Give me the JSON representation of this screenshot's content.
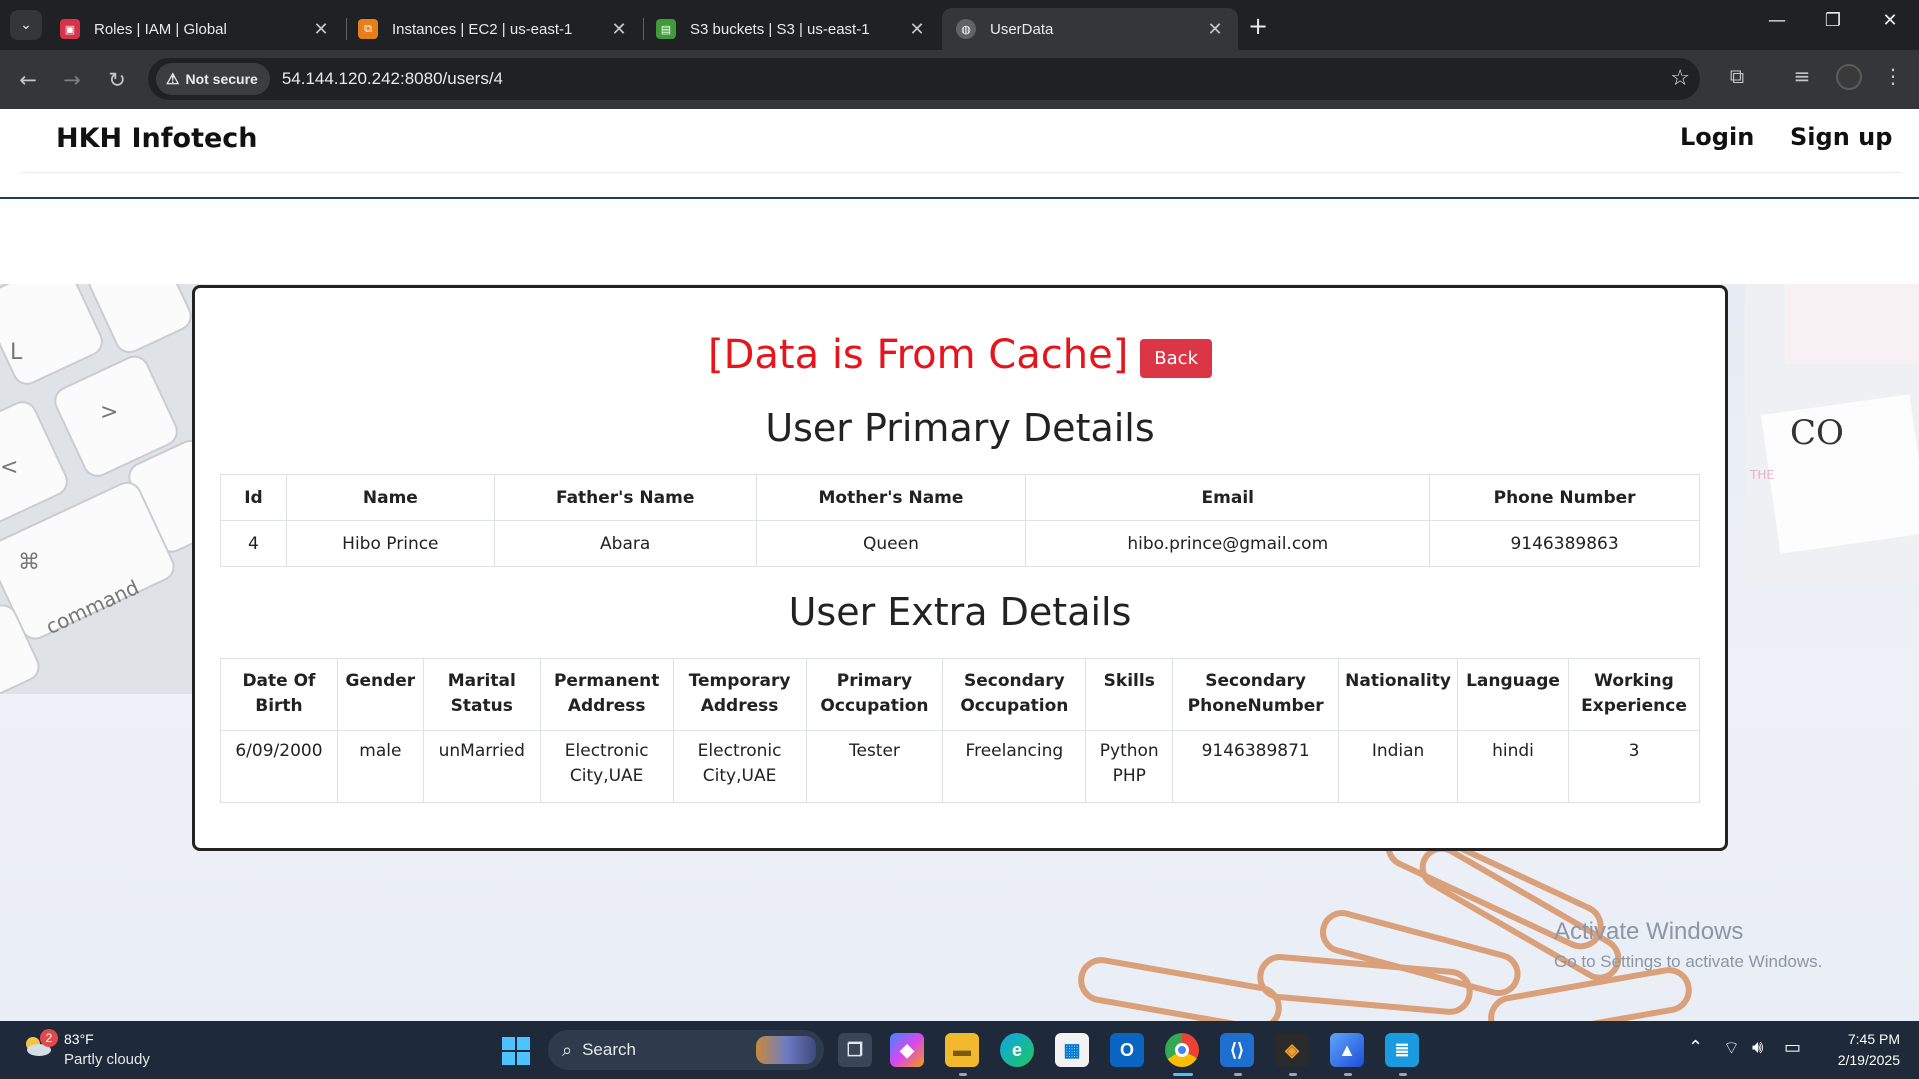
{
  "browser": {
    "tabs": [
      {
        "title": "Roles | IAM | Global",
        "active": false
      },
      {
        "title": "Instances | EC2 | us-east-1",
        "active": false
      },
      {
        "title": "S3 buckets | S3 | us-east-1",
        "active": false
      },
      {
        "title": "UserData",
        "active": true
      }
    ],
    "security_label": "Not secure",
    "url": "54.144.120.242:8080/users/4"
  },
  "site": {
    "brand": "HKH Infotech",
    "nav": {
      "login": "Login",
      "signup": "Sign up"
    }
  },
  "content": {
    "cache_title": "[Data is From Cache]",
    "back_label": "Back",
    "primary_title": "User Primary Details",
    "primary_table": {
      "headers": [
        "Id",
        "Name",
        "Father's Name",
        "Mother's Name",
        "Email",
        "Phone Number"
      ],
      "row": [
        "4",
        "Hibo Prince",
        "Abara",
        "Queen",
        "hibo.prince@gmail.com",
        "9146389863"
      ]
    },
    "extra_title": "User Extra Details",
    "extra_table": {
      "headers": [
        "Date Of Birth",
        "Gender",
        "Marital Status",
        "Permanent Address",
        "Temporary Address",
        "Primary Occupation",
        "Secondary Occupation",
        "Skills",
        "Secondary PhoneNumber",
        "Nationality",
        "Language",
        "Working Experience"
      ],
      "row": [
        "6/09/2000",
        "male",
        "unMarried",
        "Electronic City,UAE",
        "Electronic City,UAE",
        "Tester",
        "Freelancing",
        "Python PHP",
        "9146389871",
        "Indian",
        "hindi",
        "3"
      ]
    }
  },
  "watermark": {
    "line1": "Activate Windows",
    "line2": "Go to Settings to activate Windows."
  },
  "taskbar": {
    "weather_temp": "83°F",
    "weather_cond": "Partly cloudy",
    "weather_badge": "2",
    "search_label": "Search",
    "time": "7:45 PM",
    "date": "2/19/2025"
  },
  "colors": {
    "cache_title": "#e8141c",
    "back_button": "#dc3545",
    "taskbar": "#1e2a3a"
  }
}
